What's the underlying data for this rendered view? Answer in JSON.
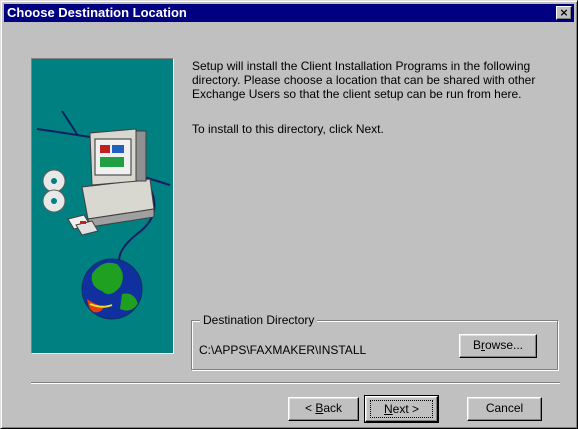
{
  "window": {
    "title": "Choose Destination Location",
    "close_glyph": "×"
  },
  "content": {
    "paragraph1": "Setup will install the Client Installation Programs in the following directory. Please choose a location that can be shared with other Exchange Users so that the client setup can be run from here.",
    "paragraph2": "To install to this directory, click Next."
  },
  "destination": {
    "group_label": "Destination Directory",
    "path": "C:\\APPS\\FAXMAKER\\INSTALL",
    "browse_pre": "B",
    "browse_mnemonic": "r",
    "browse_post": "owse..."
  },
  "buttons": {
    "back_pre": "< ",
    "back_mnemonic": "B",
    "back_post": "ack",
    "next_mnemonic": "N",
    "next_post": "ext >",
    "cancel": "Cancel"
  },
  "illustration": {
    "panel_color": "#008080",
    "icons": [
      "computer-icon",
      "cd-disc-icon",
      "floppy-disk-icon",
      "globe-icon"
    ]
  },
  "colors": {
    "titlebar": "#000080",
    "face": "#c0c0c0"
  }
}
